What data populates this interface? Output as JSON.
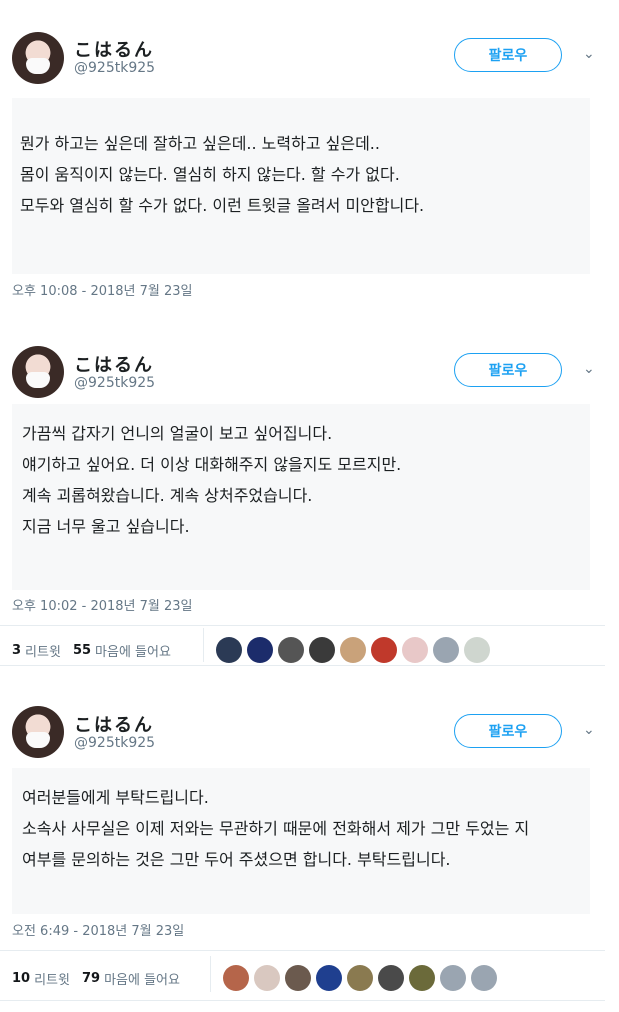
{
  "tweets": [
    {
      "name": "こはるん",
      "handle": "@925tk925",
      "follow_label": "팔로우",
      "lines": [
        "뭔가 하고는 싶은데 잘하고 싶은데.. 노력하고 싶은데..",
        "몸이 움직이지 않는다. 열심히 하지 않는다. 할 수가 없다.",
        "모두와 열심히 할 수가 없다. 이런 트윗글 올려서 미안합니다."
      ],
      "timestamp": "오후 10:08 - 2018년 7월 23일"
    },
    {
      "name": "こはるん",
      "handle": "@925tk925",
      "follow_label": "팔로우",
      "lines": [
        "가끔씩 갑자기 언니의 얼굴이 보고 싶어집니다.",
        "얘기하고 싶어요. 더 이상 대화해주지 않을지도 모르지만.",
        "계속 괴롭혀왔습니다.  계속 상처주었습니다.",
        "지금 너무 울고 싶습니다."
      ],
      "timestamp": "오후 10:02 - 2018년 7월 23일",
      "retweets": "3",
      "retweets_label": "리트윗",
      "likes": "55",
      "likes_label": "마음에 들어요",
      "liker_colors": [
        "#2b3a55",
        "#1c2c6b",
        "#555555",
        "#3a3a3a",
        "#c9a27a",
        "#c0392b",
        "#e8c8c8",
        "#9aa5b1",
        "#cfd6cf"
      ]
    },
    {
      "name": "こはるん",
      "handle": "@925tk925",
      "follow_label": "팔로우",
      "lines": [
        "여러분들에게 부탁드립니다.",
        "소속사 사무실은 이제 저와는 무관하기 때문에 전화해서 제가 그만 두었는 지",
        "여부를 문의하는 것은 그만 두어 주셨으면 합니다. 부탁드립니다."
      ],
      "timestamp": "오전 6:49 - 2018년 7월 23일",
      "retweets": "10",
      "retweets_label": "리트윗",
      "likes": "79",
      "likes_label": "마음에 들어요",
      "liker_colors": [
        "#b5654a",
        "#d9c8c0",
        "#6b5a4e",
        "#1f3f8f",
        "#8a7a50",
        "#4a4a4a",
        "#6b6a3a",
        "#9aa5b1",
        "#9aa5b1"
      ]
    }
  ]
}
